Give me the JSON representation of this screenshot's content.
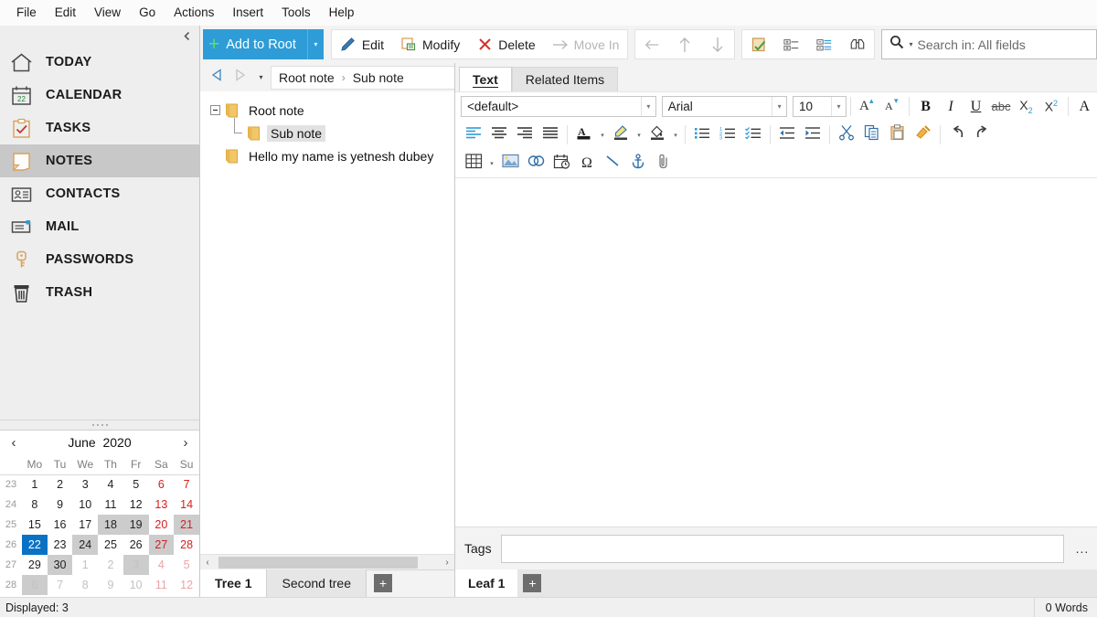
{
  "menubar": {
    "items": [
      "File",
      "Edit",
      "View",
      "Go",
      "Actions",
      "Insert",
      "Tools",
      "Help"
    ]
  },
  "sidebar": {
    "collapse_icon": "chevron-left-icon",
    "items": [
      {
        "label": "TODAY",
        "icon": "house-icon",
        "active": false
      },
      {
        "label": "CALENDAR",
        "icon": "calendar-icon",
        "active": false
      },
      {
        "label": "TASKS",
        "icon": "clipboard-check-icon",
        "active": false
      },
      {
        "label": "NOTES",
        "icon": "note-icon",
        "active": true
      },
      {
        "label": "CONTACTS",
        "icon": "contact-card-icon",
        "active": false
      },
      {
        "label": "MAIL",
        "icon": "envelope-icon",
        "active": false
      },
      {
        "label": "PASSWORDS",
        "icon": "key-icon",
        "active": false
      },
      {
        "label": "TRASH",
        "icon": "trash-icon",
        "active": false
      }
    ]
  },
  "calendar": {
    "prev_label": "‹",
    "next_label": "›",
    "month": "June",
    "year": "2020",
    "weekday_headers": [
      "",
      "Mo",
      "Tu",
      "We",
      "Th",
      "Fr",
      "Sa",
      "Su"
    ],
    "selected_day": 22,
    "weeks": [
      {
        "wk": "23",
        "days": [
          {
            "d": "1",
            "k": "n"
          },
          {
            "d": "2",
            "k": "n"
          },
          {
            "d": "3",
            "k": "n"
          },
          {
            "d": "4",
            "k": "n"
          },
          {
            "d": "5",
            "k": "n"
          },
          {
            "d": "6",
            "k": "we"
          },
          {
            "d": "7",
            "k": "we"
          }
        ]
      },
      {
        "wk": "24",
        "days": [
          {
            "d": "8",
            "k": "n"
          },
          {
            "d": "9",
            "k": "n"
          },
          {
            "d": "10",
            "k": "n"
          },
          {
            "d": "11",
            "k": "n"
          },
          {
            "d": "12",
            "k": "n"
          },
          {
            "d": "13",
            "k": "we"
          },
          {
            "d": "14",
            "k": "we"
          }
        ]
      },
      {
        "wk": "25",
        "days": [
          {
            "d": "15",
            "k": "n"
          },
          {
            "d": "16",
            "k": "n"
          },
          {
            "d": "17",
            "k": "n"
          },
          {
            "d": "18",
            "k": "n hl"
          },
          {
            "d": "19",
            "k": "n hl"
          },
          {
            "d": "20",
            "k": "we"
          },
          {
            "d": "21",
            "k": "we hl"
          }
        ]
      },
      {
        "wk": "26",
        "days": [
          {
            "d": "22",
            "k": "sel"
          },
          {
            "d": "23",
            "k": "n"
          },
          {
            "d": "24",
            "k": "n hl"
          },
          {
            "d": "25",
            "k": "n"
          },
          {
            "d": "26",
            "k": "n"
          },
          {
            "d": "27",
            "k": "we hl"
          },
          {
            "d": "28",
            "k": "we"
          }
        ]
      },
      {
        "wk": "27",
        "days": [
          {
            "d": "29",
            "k": "n"
          },
          {
            "d": "30",
            "k": "n hl"
          },
          {
            "d": "1",
            "k": "out"
          },
          {
            "d": "2",
            "k": "out"
          },
          {
            "d": "3",
            "k": "out hl"
          },
          {
            "d": "4",
            "k": "out we"
          },
          {
            "d": "5",
            "k": "out we"
          }
        ]
      },
      {
        "wk": "28",
        "days": [
          {
            "d": "6",
            "k": "out hl"
          },
          {
            "d": "7",
            "k": "out"
          },
          {
            "d": "8",
            "k": "out"
          },
          {
            "d": "9",
            "k": "out"
          },
          {
            "d": "10",
            "k": "out"
          },
          {
            "d": "11",
            "k": "out we"
          },
          {
            "d": "12",
            "k": "out we"
          }
        ]
      }
    ]
  },
  "toolbar": {
    "add_label": "Add to Root",
    "add_plus": "+",
    "add_dropdown_caret": "▾",
    "edit_label": "Edit",
    "modify_label": "Modify",
    "delete_label": "Delete",
    "movein_label": "Move In",
    "back_icon": "arrow-left-icon",
    "up_icon": "arrow-up-icon",
    "down_icon": "arrow-down-icon",
    "marknote_icon": "note-check-icon",
    "expandall_icon": "expand-all-icon",
    "collapseall_icon": "collapse-all-icon",
    "findsimilar_icon": "binoculars-icon"
  },
  "search": {
    "icon": "search-icon",
    "caret": "▾",
    "placeholder": "Search in: All fields",
    "value": ""
  },
  "breadcrumb": {
    "back_icon": "triangle-left-icon",
    "forward_icon": "triangle-right-icon",
    "history_caret": "▾",
    "path": [
      "Root note",
      "Sub note"
    ],
    "separator": "›"
  },
  "tree": {
    "expander": "−",
    "nodes": [
      {
        "label": "Root note",
        "level": 0,
        "selected": false,
        "expander": true
      },
      {
        "label": "Sub note",
        "level": 1,
        "selected": true,
        "expander": false
      },
      {
        "label": "Hello my name is yetnesh dubey",
        "level": 0,
        "selected": false,
        "expander": false
      }
    ],
    "scroll_left": "‹",
    "scroll_right": "›",
    "tabs": [
      {
        "label": "Tree 1",
        "active": true
      },
      {
        "label": "Second tree",
        "active": false
      }
    ],
    "add_tab_label": "+"
  },
  "editor": {
    "tabs": [
      {
        "label": "Text",
        "active": true,
        "accesskey": "T"
      },
      {
        "label": "Related Items",
        "active": false,
        "accesskey": ""
      }
    ],
    "style_combo": {
      "value": "<default>",
      "caret": "▾"
    },
    "font_combo": {
      "value": "Arial",
      "caret": "▾"
    },
    "size_combo": {
      "value": "10",
      "caret": "▾"
    },
    "row1_icons": [
      "grow-font-icon",
      "shrink-font-icon",
      "bold-icon",
      "italic-icon",
      "underline-icon",
      "strikethrough-icon",
      "subscript-icon",
      "superscript-icon",
      "font-color-icon"
    ],
    "row2_icons": [
      "align-left-icon",
      "align-center-icon",
      "align-right-icon",
      "align-justify-icon",
      "text-color-icon",
      "highlight-icon",
      "fill-color-icon",
      "bullet-list-icon",
      "numbered-list-icon",
      "checklist-icon",
      "decrease-indent-icon",
      "increase-indent-icon",
      "cut-icon",
      "copy-icon",
      "paste-icon",
      "format-painter-icon",
      "undo-icon",
      "redo-icon"
    ],
    "row3_icons": [
      "table-icon",
      "image-icon",
      "link-icon",
      "date-stamp-icon",
      "symbol-icon",
      "horizontal-line-icon",
      "anchor-icon",
      "attachment-icon"
    ],
    "body_text": ""
  },
  "tags": {
    "label": "Tags",
    "value": "",
    "placeholder": "",
    "more_button": "..."
  },
  "leaf_tabs": {
    "tabs": [
      {
        "label": "Leaf 1",
        "active": true
      }
    ],
    "add_tab_label": "+"
  },
  "statusbar": {
    "left": "Displayed: 3",
    "right": "0 Words"
  },
  "colors": {
    "accent_blue": "#2e9cd6",
    "plus_green": "#5fe06a",
    "selection_blue": "#0a72c4",
    "weekend_red": "#d42020",
    "sidebar_bg": "#eeeeee",
    "sidebar_active": "#c8c8c8",
    "folder_yellow": "#f0c674",
    "toolbar_bg": "#f3f3f3"
  }
}
